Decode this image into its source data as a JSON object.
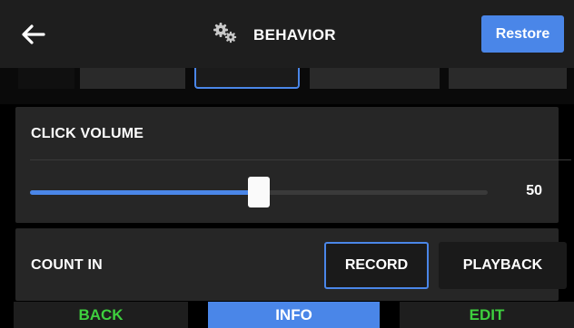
{
  "header": {
    "title": "BEHAVIOR",
    "restore_label": "Restore",
    "back_icon": "arrow-left-icon",
    "title_icon": "gears-icon"
  },
  "click_volume": {
    "label": "CLICK VOLUME",
    "value": "50",
    "fraction": 0.5
  },
  "count_in": {
    "label": "COUNT IN",
    "options": [
      "RECORD",
      "PLAYBACK"
    ],
    "selected": "RECORD"
  },
  "bottom_tabs": {
    "back": "BACK",
    "info": "INFO",
    "edit": "EDIT",
    "active": "INFO"
  },
  "colors": {
    "accent": "#4a86e8",
    "tab_text_green": "#3ecf3e",
    "tab_text_active": "#ffffff",
    "panel": "#262626"
  }
}
